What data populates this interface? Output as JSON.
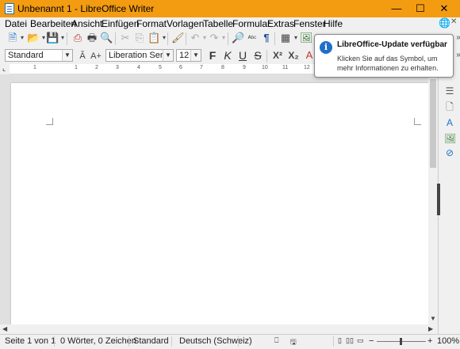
{
  "window": {
    "title": "Unbenannt 1 - LibreOffice Writer",
    "minimize": "—",
    "maximize": "☐",
    "close": "✕"
  },
  "menu": {
    "items": [
      "Datei",
      "Bearbeiten",
      "Ansicht",
      "Einfügen",
      "Format",
      "Vorlagen",
      "Tabelle",
      "Formular",
      "Extras",
      "Fenster",
      "Hilfe"
    ],
    "close_doc": "✕"
  },
  "formatting": {
    "paragraph_style": "Standard",
    "font_name": "Liberation Serif",
    "font_size": "12",
    "bold": "F",
    "italic": "K",
    "underline": "U",
    "strikethrough": "S",
    "superscript": "X²",
    "subscript": "X₂"
  },
  "ruler": {
    "numbers": [
      "1",
      "1",
      "2",
      "3",
      "4",
      "5",
      "6",
      "7",
      "8",
      "9",
      "10",
      "11",
      "12"
    ]
  },
  "notification": {
    "title": "LibreOffice-Update verfügbar",
    "body": "Klicken Sie auf das Symbol, um mehr Informationen zu erhalten."
  },
  "status": {
    "page": "Seite 1 von 1",
    "words": "0 Wörter, 0 Zeichen",
    "page_style": "Standard",
    "language": "Deutsch (Schweiz)",
    "zoom_out": "−",
    "zoom_in": "+",
    "zoom": "100%"
  },
  "colors": {
    "titlebar": "#f39c12",
    "accent": "#1e6fc7"
  }
}
